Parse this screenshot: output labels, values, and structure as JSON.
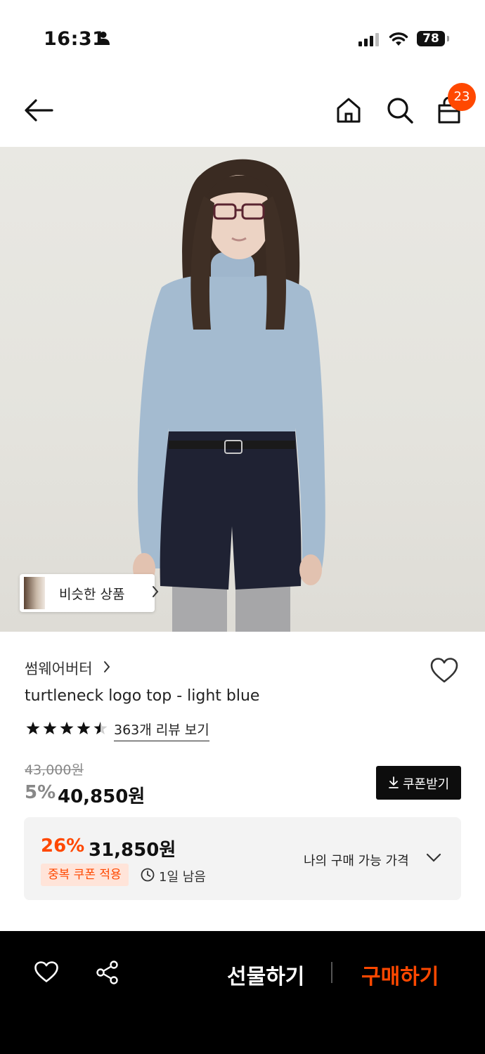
{
  "status_bar": {
    "time": "16:31",
    "battery": "78",
    "icons": [
      "person-icon",
      "signal-icon",
      "wifi-icon",
      "battery-icon"
    ]
  },
  "nav": {
    "icons": [
      "back-arrow-icon",
      "home-icon",
      "search-icon",
      "shopping-bag-icon"
    ],
    "cart_count": "23"
  },
  "product": {
    "image_alt": "model wearing light blue turtleneck top",
    "similar_button_label": "비슷한 상품",
    "brand": "썸웨어버터",
    "title": "turtleneck logo top - light blue",
    "rating_stars": 4.5,
    "reviews_link": "363개 리뷰 보기"
  },
  "pricing": {
    "original_price": "43,000원",
    "discount_percent": "5%",
    "discounted_price": "40,850원",
    "coupon_button_label": "쿠폰받기"
  },
  "best_price": {
    "percent": "26%",
    "price": "31,850원",
    "coupon_tag": "중복 쿠폰 적용",
    "time_left": "1일 남음",
    "my_price_label": "나의 구매 가능 가격"
  },
  "bottom_bar": {
    "gift_label": "선물하기",
    "buy_label": "구매하기"
  },
  "colors": {
    "accent": "#ff4800",
    "bottom_bar_bg": "#000000"
  }
}
